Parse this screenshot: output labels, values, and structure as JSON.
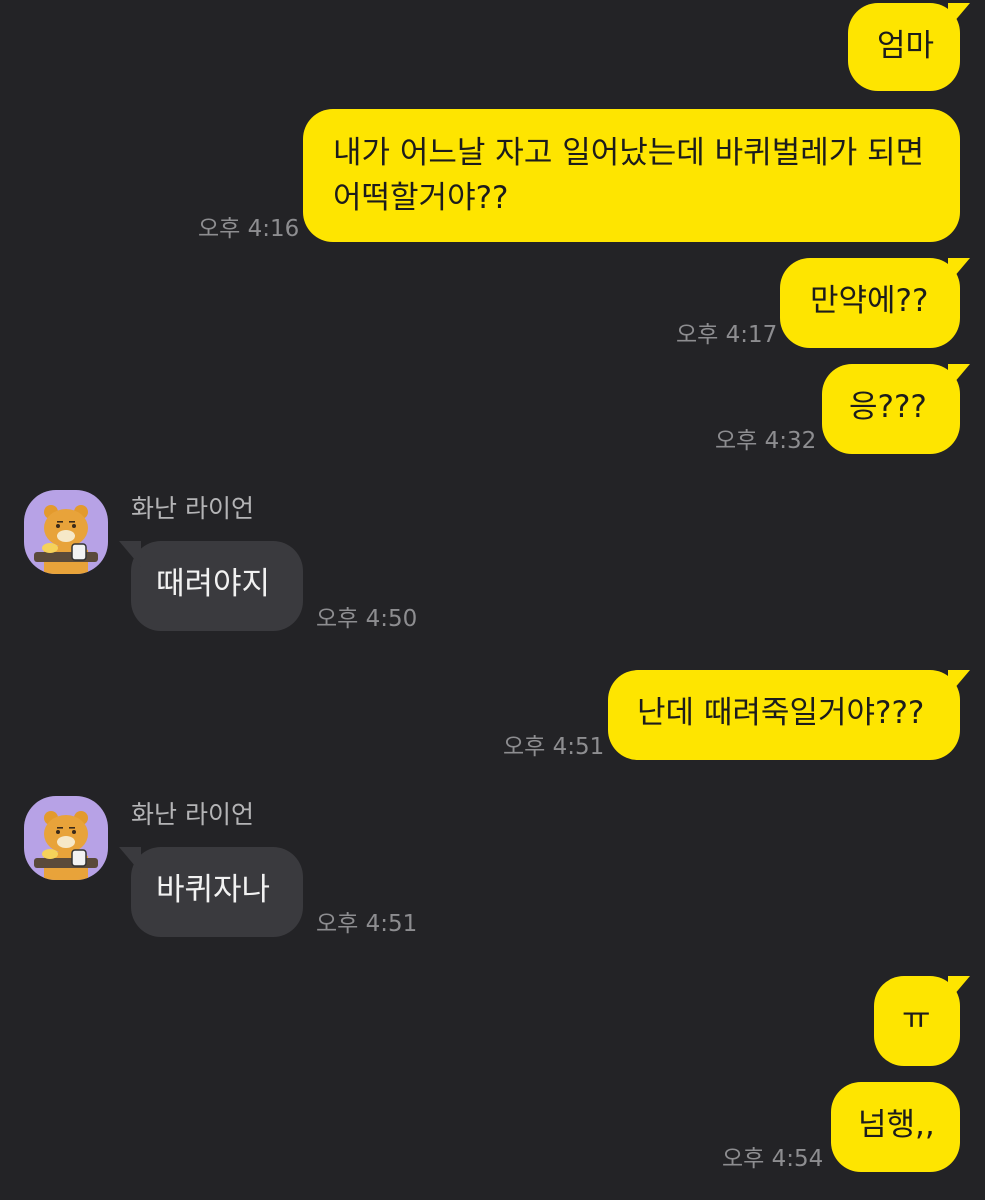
{
  "messages": [
    {
      "id": "m1",
      "text": "엄마"
    },
    {
      "id": "m2",
      "line1": "내가 어느날 자고 일어났는데 바퀴벌레가 되면",
      "line2": "어떡할거야??",
      "time": "오후 4:16"
    },
    {
      "id": "m3",
      "text": "만약에??",
      "time": "오후 4:17"
    },
    {
      "id": "m4",
      "text": "응???",
      "time": "오후 4:32"
    },
    {
      "id": "m5",
      "sender": "화난 라이언",
      "text": "때려야지",
      "time": "오후 4:50"
    },
    {
      "id": "m6",
      "text": "난데 때려죽일거야???",
      "time": "오후 4:51"
    },
    {
      "id": "m7",
      "sender": "화난 라이언",
      "text": "바퀴자나",
      "time": "오후 4:51"
    },
    {
      "id": "m8",
      "text": "ㅠ"
    },
    {
      "id": "m9",
      "text": "넘행,,",
      "time": "오후 4:54"
    }
  ],
  "colors": {
    "background": "#232326",
    "my_bubble": "#fee500",
    "their_bubble": "#3a3a3e",
    "avatar_bg": "#b7a2e6"
  },
  "avatar_icon": "ryan-character-icon"
}
